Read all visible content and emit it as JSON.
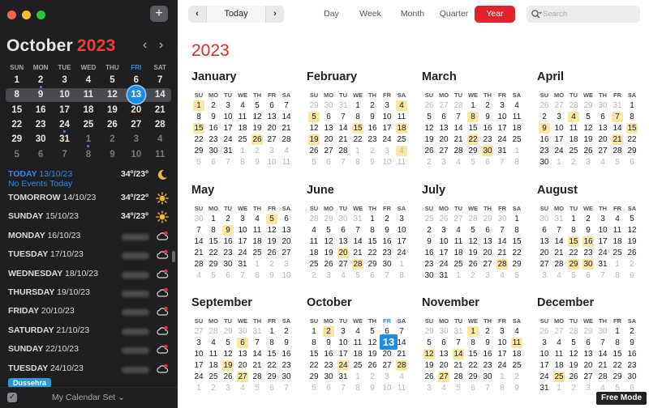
{
  "window": {
    "add_label": "+"
  },
  "sidebar": {
    "month": "October",
    "year": "2023",
    "prev": "‹",
    "next": "›",
    "weekdays": [
      "SUN",
      "MON",
      "TUE",
      "WED",
      "THU",
      "FRI",
      "SAT"
    ],
    "weeks": [
      [
        {
          "d": "1"
        },
        {
          "d": "2",
          "dot": true
        },
        {
          "d": "3"
        },
        {
          "d": "4"
        },
        {
          "d": "5"
        },
        {
          "d": "6"
        },
        {
          "d": "7"
        }
      ],
      [
        {
          "d": "8"
        },
        {
          "d": "9"
        },
        {
          "d": "10"
        },
        {
          "d": "11"
        },
        {
          "d": "12"
        },
        {
          "d": "13",
          "today": true
        },
        {
          "d": "14"
        }
      ],
      [
        {
          "d": "15"
        },
        {
          "d": "16"
        },
        {
          "d": "17"
        },
        {
          "d": "18"
        },
        {
          "d": "19"
        },
        {
          "d": "20"
        },
        {
          "d": "21"
        }
      ],
      [
        {
          "d": "22"
        },
        {
          "d": "23"
        },
        {
          "d": "24",
          "dot": true
        },
        {
          "d": "25"
        },
        {
          "d": "26"
        },
        {
          "d": "27"
        },
        {
          "d": "28"
        }
      ],
      [
        {
          "d": "29"
        },
        {
          "d": "30"
        },
        {
          "d": "31"
        },
        {
          "d": "1",
          "dim": true,
          "dot": true
        },
        {
          "d": "2",
          "dim": true
        },
        {
          "d": "3",
          "dim": true
        },
        {
          "d": "4",
          "dim": true
        }
      ],
      [
        {
          "d": "5",
          "dim": true
        },
        {
          "d": "6",
          "dim": true
        },
        {
          "d": "7",
          "dim": true
        },
        {
          "d": "8",
          "dim": true
        },
        {
          "d": "9",
          "dim": true
        },
        {
          "d": "10",
          "dim": true
        },
        {
          "d": "11",
          "dim": true
        }
      ]
    ],
    "highlight_week": 1,
    "agenda": [
      {
        "label": "TODAY",
        "date": "13/10/23",
        "sub": "No Events Today",
        "temp": "34º/23º",
        "icon": "moon-icon",
        "today": true
      },
      {
        "label": "TOMORROW",
        "date": "14/10/23",
        "temp": "34º/22º",
        "icon": "sun-icon"
      },
      {
        "label": "SUNDAY",
        "date": "15/10/23",
        "temp": "34º/23º",
        "icon": "sun-icon"
      },
      {
        "label": "MONDAY",
        "date": "16/10/23",
        "icon": "cloud-rain-icon"
      },
      {
        "label": "TUESDAY",
        "date": "17/10/23",
        "icon": "cloud-rain-icon"
      },
      {
        "label": "WEDNESDAY",
        "date": "18/10/23",
        "icon": "cloud-rain-icon"
      },
      {
        "label": "THURSDAY",
        "date": "19/10/23",
        "icon": "cloud-rain-icon"
      },
      {
        "label": "FRIDAY",
        "date": "20/10/23",
        "icon": "cloud-rain-icon"
      },
      {
        "label": "SATURDAY",
        "date": "21/10/23",
        "icon": "cloud-rain-icon"
      },
      {
        "label": "SUNDAY",
        "date": "22/10/23",
        "icon": "cloud-rain-icon"
      },
      {
        "label": "TUESDAY",
        "date": "24/10/23",
        "icon": "cloud-rain-icon"
      }
    ],
    "event_pill": "Dussehra",
    "calendar_set": "My Calendar Set",
    "calendar_set_chevron": "⌄"
  },
  "toolbar": {
    "prev": "‹",
    "today": "Today",
    "next": "›",
    "views": [
      "Day",
      "Week",
      "Month",
      "Quarter",
      "Year"
    ],
    "active_view": "Year",
    "search_placeholder": "Search"
  },
  "year_view": {
    "year": "2023",
    "weekdays": [
      "SU",
      "MO",
      "TU",
      "WE",
      "TH",
      "FR",
      "SA"
    ],
    "months": [
      {
        "name": "January",
        "first": 0,
        "days": 31,
        "prevdays": 31,
        "events": [
          1,
          15,
          26
        ]
      },
      {
        "name": "February",
        "first": 3,
        "days": 28,
        "prevdays": 31,
        "events": [
          4,
          5,
          15,
          18,
          19
        ],
        "dimevents": [
          4
        ]
      },
      {
        "name": "March",
        "first": 3,
        "days": 31,
        "prevdays": 28,
        "events": [
          8,
          22,
          30
        ]
      },
      {
        "name": "April",
        "first": 6,
        "days": 30,
        "prevdays": 31,
        "events": [
          4,
          7,
          9,
          15,
          21
        ]
      },
      {
        "name": "May",
        "first": 1,
        "days": 31,
        "prevdays": 30,
        "events": [
          5,
          9
        ]
      },
      {
        "name": "June",
        "first": 4,
        "days": 30,
        "prevdays": 31,
        "events": [
          20,
          28
        ]
      },
      {
        "name": "July",
        "first": 6,
        "days": 31,
        "prevdays": 30,
        "events": [
          28
        ]
      },
      {
        "name": "August",
        "first": 2,
        "days": 31,
        "prevdays": 31,
        "events": [
          15,
          16,
          29,
          30
        ]
      },
      {
        "name": "September",
        "first": 5,
        "days": 30,
        "prevdays": 31,
        "events": [
          6,
          19,
          27
        ]
      },
      {
        "name": "October",
        "first": 0,
        "days": 31,
        "prevdays": 30,
        "events": [
          2,
          24,
          28
        ],
        "today": 13
      },
      {
        "name": "November",
        "first": 3,
        "days": 30,
        "prevdays": 31,
        "events": [
          1,
          11,
          12,
          14,
          27
        ]
      },
      {
        "name": "December",
        "first": 5,
        "days": 31,
        "prevdays": 30,
        "events": [
          25
        ]
      }
    ]
  },
  "free_mode": "Free Mode",
  "colors": {
    "accent": "#e2212a",
    "today": "#1e8ce4",
    "event": "#f9e7a4",
    "sidebar": "#1f1f21"
  }
}
